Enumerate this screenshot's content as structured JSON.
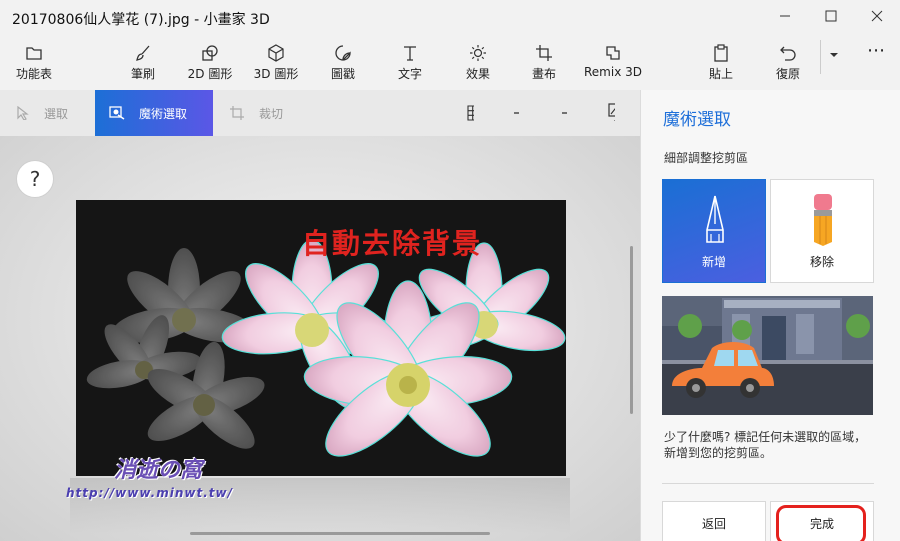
{
  "window": {
    "title": "20170806仙人掌花 (7).jpg - 小畫家 3D"
  },
  "toolbar": {
    "menu_label": "功能表",
    "brush_label": "筆刷",
    "shapes2d_label": "2D 圖形",
    "shapes3d_label": "3D 圖形",
    "stickers_label": "圖戳",
    "text_label": "文字",
    "effects_label": "效果",
    "canvas_label": "畫布",
    "remix_label": "Remix 3D",
    "paste_label": "貼上",
    "undo_label": "復原"
  },
  "subtoolbar": {
    "select_label": "選取",
    "magic_select_label": "魔術選取",
    "crop_label": "裁切"
  },
  "canvas": {
    "help_label": "?",
    "overlay_text": "自動去除背景",
    "watermark_title": "消逝の窩",
    "watermark_url": "http://www.minwt.tw/"
  },
  "panel": {
    "title": "魔術選取",
    "subtitle": "細部調整挖剪區",
    "add_label": "新增",
    "remove_label": "移除",
    "hint": "少了什麼嗎? 標記任何未選取的區域，新增到您的挖剪區。",
    "back_label": "返回",
    "done_label": "完成"
  },
  "colors": {
    "accent": "#1e6fd9",
    "highlight_ring": "#e4211d",
    "overlay_text": "#e0231f"
  }
}
